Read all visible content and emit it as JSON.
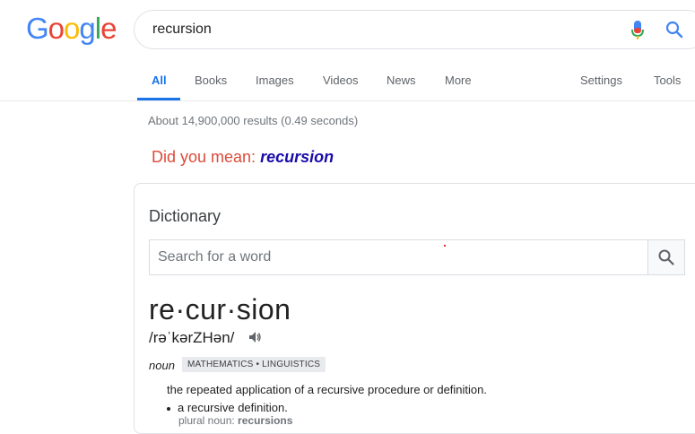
{
  "logo": {
    "letters": [
      "G",
      "o",
      "o",
      "g",
      "l",
      "e"
    ],
    "colors": [
      "#4285f4",
      "#ea4335",
      "#fbbc05",
      "#4285f4",
      "#34a853",
      "#ea4335"
    ]
  },
  "search": {
    "query": "recursion",
    "mic_icon": "microphone-icon",
    "search_icon": "search-icon"
  },
  "nav": {
    "tabs": [
      {
        "label": "All",
        "active": true
      },
      {
        "label": "Books"
      },
      {
        "label": "Images"
      },
      {
        "label": "Videos"
      },
      {
        "label": "News"
      },
      {
        "label": "More"
      }
    ],
    "right": [
      {
        "label": "Settings"
      },
      {
        "label": "Tools"
      }
    ]
  },
  "results": {
    "stats": "About 14,900,000 results (0.49 seconds)",
    "did_you_mean_prefix": "Did you mean: ",
    "did_you_mean_term": "recursion"
  },
  "dictionary": {
    "title": "Dictionary",
    "search_placeholder": "Search for a word",
    "headword": "re·cur·sion",
    "phonetic": "/rəˈkərZHən/",
    "part_of_speech": "noun",
    "tags": "MATHEMATICS • LINGUISTICS",
    "definition": "the repeated application of a recursive procedure or definition.",
    "sub_definition": "a recursive definition.",
    "plural_label": "plural noun: ",
    "plural_value": "recursions"
  },
  "colors": {
    "accent": "#1a73e8",
    "did_you_mean": "#dd4b39",
    "link": "#1a0dab"
  }
}
